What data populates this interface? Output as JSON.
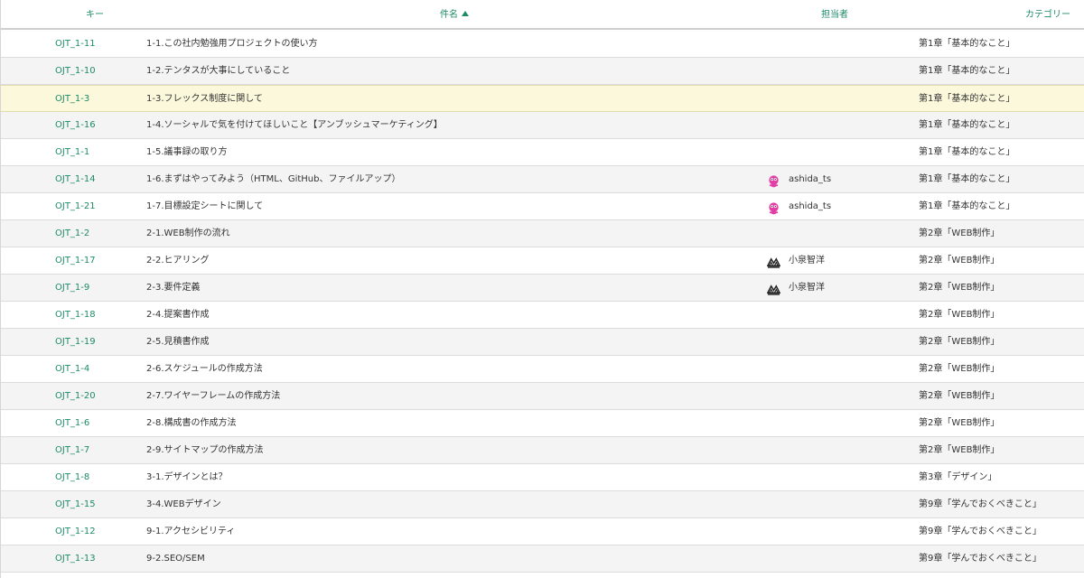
{
  "header": {
    "key": "キー",
    "summary": "件名",
    "assignee": "担当者",
    "category": "カテゴリー"
  },
  "colors": {
    "accent": "#1e8a6a",
    "selected_row": "#fbf8dc",
    "alt_row": "#f4f4f4",
    "avatar_pink": "#e33ea6"
  },
  "rows": [
    {
      "key": "OJT_1-11",
      "summary": "1-1.この社内勉強用プロジェクトの使い方",
      "assignee": "",
      "avatar": "",
      "category": "第1章「基本的なこと」"
    },
    {
      "key": "OJT_1-10",
      "summary": "1-2.テンタスが大事にしていること",
      "assignee": "",
      "avatar": "",
      "category": "第1章「基本的なこと」"
    },
    {
      "key": "OJT_1-3",
      "summary": "1-3.フレックス制度に関して",
      "assignee": "",
      "avatar": "",
      "category": "第1章「基本的なこと」",
      "selected": true
    },
    {
      "key": "OJT_1-16",
      "summary": "1-4.ソーシャルで気を付けてほしいこと【アンブッシュマーケティング】",
      "assignee": "",
      "avatar": "",
      "category": "第1章「基本的なこと」"
    },
    {
      "key": "OJT_1-1",
      "summary": "1-5.議事録の取り方",
      "assignee": "",
      "avatar": "",
      "category": "第1章「基本的なこと」"
    },
    {
      "key": "OJT_1-14",
      "summary": "1-6.まずはやってみよう（HTML、GitHub、ファイルアップ）",
      "assignee": "ashida_ts",
      "avatar": "pink-face-icon",
      "category": "第1章「基本的なこと」"
    },
    {
      "key": "OJT_1-21",
      "summary": "1-7.目標設定シートに関して",
      "assignee": "ashida_ts",
      "avatar": "pink-face-icon",
      "category": "第1章「基本的なこと」"
    },
    {
      "key": "OJT_1-2",
      "summary": "2-1.WEB制作の流れ",
      "assignee": "",
      "avatar": "",
      "category": "第2章「WEB制作」"
    },
    {
      "key": "OJT_1-17",
      "summary": "2-2.ヒアリング",
      "assignee": "小泉智洋",
      "avatar": "mountain-logo-icon",
      "category": "第2章「WEB制作」"
    },
    {
      "key": "OJT_1-9",
      "summary": "2-3.要件定義",
      "assignee": "小泉智洋",
      "avatar": "mountain-logo-icon",
      "category": "第2章「WEB制作」"
    },
    {
      "key": "OJT_1-18",
      "summary": "2-4.提案書作成",
      "assignee": "",
      "avatar": "",
      "category": "第2章「WEB制作」"
    },
    {
      "key": "OJT_1-19",
      "summary": "2-5.見積書作成",
      "assignee": "",
      "avatar": "",
      "category": "第2章「WEB制作」"
    },
    {
      "key": "OJT_1-4",
      "summary": "2-6.スケジュールの作成方法",
      "assignee": "",
      "avatar": "",
      "category": "第2章「WEB制作」"
    },
    {
      "key": "OJT_1-20",
      "summary": "2-7.ワイヤーフレームの作成方法",
      "assignee": "",
      "avatar": "",
      "category": "第2章「WEB制作」"
    },
    {
      "key": "OJT_1-6",
      "summary": "2-8.構成書の作成方法",
      "assignee": "",
      "avatar": "",
      "category": "第2章「WEB制作」"
    },
    {
      "key": "OJT_1-7",
      "summary": "2-9.サイトマップの作成方法",
      "assignee": "",
      "avatar": "",
      "category": "第2章「WEB制作」"
    },
    {
      "key": "OJT_1-8",
      "summary": "3-1.デザインとは？",
      "assignee": "",
      "avatar": "",
      "category": "第3章「デザイン」"
    },
    {
      "key": "OJT_1-15",
      "summary": "3-4.WEBデザイン",
      "assignee": "",
      "avatar": "",
      "category": "第9章「学んでおくべきこと」"
    },
    {
      "key": "OJT_1-12",
      "summary": "9-1.アクセシビリティ",
      "assignee": "",
      "avatar": "",
      "category": "第9章「学んでおくべきこと」"
    },
    {
      "key": "OJT_1-13",
      "summary": "9-2.SEO/SEM",
      "assignee": "",
      "avatar": "",
      "category": "第9章「学んでおくべきこと」"
    }
  ]
}
